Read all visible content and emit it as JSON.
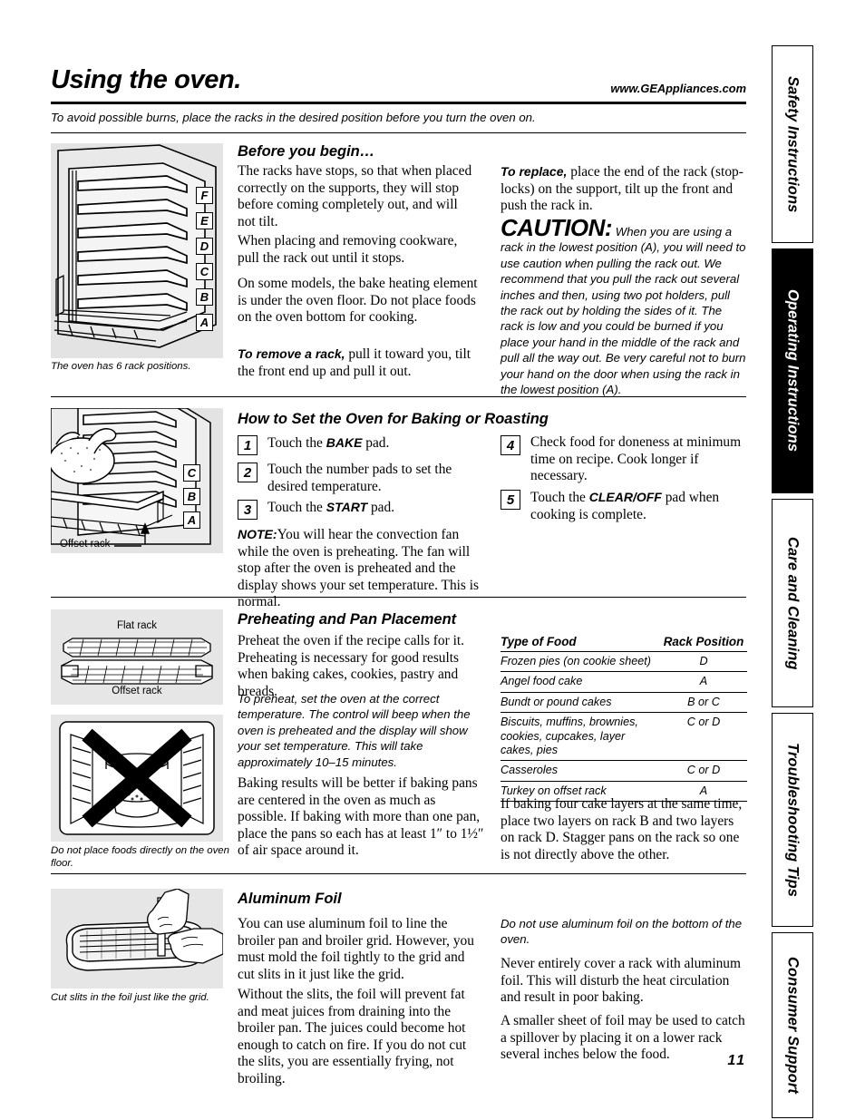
{
  "header": {
    "title": "Using the oven.",
    "website": "www.GEAppliances.com",
    "subtitle": "To avoid possible burns, place the racks in the desired position before you turn the oven on."
  },
  "page_number": "11",
  "sidebar": {
    "tabs": [
      {
        "label": "Safety Instructions",
        "active": false
      },
      {
        "label": "Operating Instructions",
        "active": true
      },
      {
        "label": "Care and Cleaning",
        "active": false
      },
      {
        "label": "Troubleshooting Tips",
        "active": false
      },
      {
        "label": "Consumer Support",
        "active": false
      }
    ]
  },
  "section_before": {
    "heading": "Before you begin…",
    "p1": "The racks have stops, so that when placed correctly on the supports, they will stop before coming completely out, and will not tilt.",
    "p2": "When placing and removing cookware, pull the rack out until it stops.",
    "p3": "On some models, the bake heating element is under the oven floor. Do not place foods on the oven bottom for cooking.",
    "p4_bold": "To remove a rack,",
    "p4": " pull it toward you, tilt the front end up and pull it out.",
    "right_bold": "To replace,",
    "right_p": " place the end of the rack (stop-locks) on the support, tilt up the front and push the rack in.",
    "caution_head": "CAUTION:",
    "caution_text": "When you are using a rack in the lowest position (A), you will need to use caution when pulling the rack out. We recommend that you pull the rack out several inches and then, using two pot holders, pull the rack out by holding the sides of it. The rack is low and you could be burned if you place your hand in the middle of the rack and pull all the way out. Be very careful not to burn your hand on the door when using the rack in the lowest position (A).",
    "figure_caption": "The oven has 6 rack positions.",
    "rack_letters": [
      "F",
      "E",
      "D",
      "C",
      "B",
      "A"
    ]
  },
  "section_baking": {
    "heading": "How to Set the Oven for Baking or Roasting",
    "steps": [
      {
        "num": "1",
        "text": "Touch the ",
        "bold": "BAKE",
        "tail": " pad."
      },
      {
        "num": "2",
        "text": "Touch the number pads to set the desired temperature.",
        "bold": "",
        "tail": ""
      },
      {
        "num": "3",
        "text": "Touch the ",
        "bold": "START",
        "tail": " pad."
      },
      {
        "num": "4",
        "text": "Check food for doneness at minimum time on recipe. Cook longer if necessary.",
        "bold": "",
        "tail": ""
      },
      {
        "num": "5",
        "text": "Touch the ",
        "bold": "CLEAR/OFF",
        "tail": " pad when cooking is complete."
      }
    ],
    "note_bold": "NOTE:",
    "note_text": "You will hear the convection fan while the oven is preheating. The fan will stop after the oven is preheated and the display shows your set temperature. This is normal.",
    "figure_label": "Offset rack",
    "rack_letters": [
      "C",
      "B",
      "A"
    ]
  },
  "section_preheat": {
    "heading": "Preheating and Pan Placement",
    "p1": "Preheat the oven if the recipe calls for it. Preheating is necessary for good results when baking cakes, cookies, pastry and breads.",
    "p2_italic": "To preheat, set the oven at the correct temperature. The control will beep when the oven is preheated and the display will show your set temperature. This will take approximately 10–15 minutes.",
    "p3": "Baking results will be better if baking pans are centered in the oven as much as possible. If baking with more than one pan, place the pans so each has at least 1″ to 1½″ of air space around it.",
    "fig1_top_label": "Flat rack",
    "fig1_bottom_label": "Offset rack",
    "fig2_caption": "Do not place foods directly on the oven floor.",
    "table": {
      "headers": [
        "Type of Food",
        "Rack Position"
      ],
      "rows": [
        {
          "food": "Frozen pies (on cookie sheet)",
          "rack": "D"
        },
        {
          "food": "Angel food cake",
          "rack": "A"
        },
        {
          "food": "Bundt or pound cakes",
          "rack": "B or C"
        },
        {
          "food": "Biscuits, muffins, brownies, cookies, cupcakes, layer cakes, pies",
          "rack": "C or D"
        },
        {
          "food": "Casseroles",
          "rack": "C or D"
        },
        {
          "food": "Turkey on offset rack",
          "rack": "A"
        }
      ]
    },
    "table_note": "If baking four cake layers at the same time, place two layers on rack B and two layers on rack D. Stagger pans on the rack so one is not directly above the other."
  },
  "section_foil": {
    "heading": "Aluminum Foil",
    "p1": "You can use aluminum foil to line the broiler pan and broiler grid. However, you must mold the foil tightly to the grid and cut slits in it just like the grid.",
    "p2": "Without the slits, the foil will prevent fat and meat juices from draining into the broiler pan. The juices could become hot enough to catch on fire. If you do not cut the slits, you are essentially frying, not broiling.",
    "r1_italic": "Do not use aluminum foil on the bottom of the oven.",
    "r2": "Never entirely cover a rack with aluminum foil. This will disturb the heat circulation and result in poor baking.",
    "r3": "A smaller sheet of foil may be used to catch a spillover by placing it on a lower rack several inches below the food.",
    "figure_caption": "Cut slits in the foil just like the grid."
  }
}
